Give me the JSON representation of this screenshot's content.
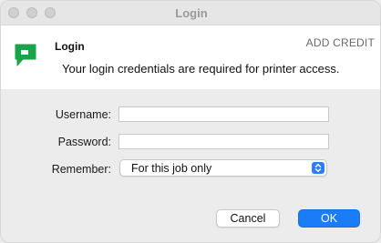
{
  "window": {
    "title": "Login"
  },
  "header": {
    "title": "Login",
    "add_credit": "ADD CREDIT",
    "message": "Your login credentials are required for printer access.",
    "logo_icon": "papercut-logo-icon",
    "logo_color": "#1aa34a"
  },
  "form": {
    "username_label": "Username:",
    "username_value": "",
    "password_label": "Password:",
    "password_value": "",
    "remember_label": "Remember:",
    "remember_value": "For this job only",
    "remember_stepper_icon": "up-down-chevron-icon"
  },
  "buttons": {
    "cancel_label": "Cancel",
    "ok_label": "OK"
  },
  "colors": {
    "accent": "#1a7cf6"
  }
}
